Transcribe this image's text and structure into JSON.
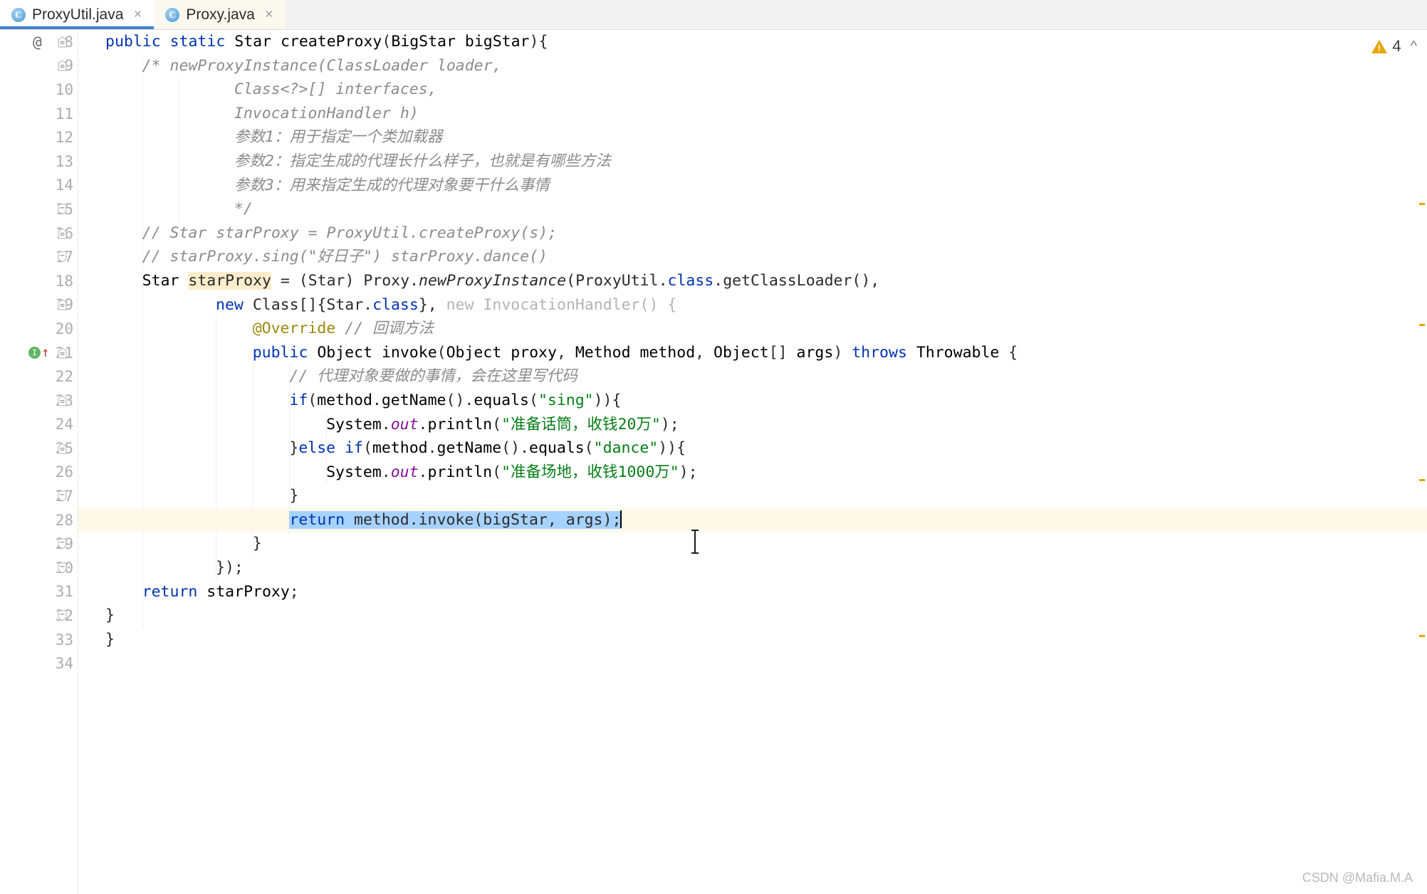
{
  "window": {
    "app": "IntelliJ IDEA Editor",
    "watermark": "CSDN @Mafia.M.A"
  },
  "tabs": [
    {
      "label": "ProxyUtil.java",
      "icon": "java-class-icon",
      "icon_letter": "C",
      "active": true,
      "close": "×"
    },
    {
      "label": "Proxy.java",
      "icon": "java-class-icon",
      "icon_letter": "C",
      "active": false,
      "close": "×"
    }
  ],
  "inspection": {
    "warning_icon": "warning-triangle-icon",
    "warning_count": "4",
    "collapse_icon": "chevron-up-icon"
  },
  "gutter": {
    "annotation_marker": "@",
    "run_marker_glyph": "I",
    "override_arrow": "↑"
  },
  "editor": {
    "language": "Java",
    "first_line_number": 8,
    "current_line": 28,
    "highlighted_identifier": "starProxy",
    "selection_text": "return method.invoke(bigStar, args);",
    "colors": {
      "keyword": "#0033b3",
      "string": "#067d17",
      "comment": "#8c8c8c",
      "annotation": "#9e880d",
      "static_field": "#871094",
      "greyed": "#b4b4b4",
      "identifier_highlight": "#fbeccb",
      "selection": "#a6d2ff",
      "current_line": "#fcf9e9",
      "tab_underline": "#3f7fd0"
    },
    "lines": [
      {
        "n": 8,
        "gutter": "at",
        "fold": "start",
        "text": "public static Star createProxy(BigStar bigStar){"
      },
      {
        "n": 9,
        "gutter": "",
        "fold": "start",
        "text": "    /* newProxyInstance(ClassLoader loader,"
      },
      {
        "n": 10,
        "gutter": "",
        "fold": "",
        "text": "              Class<?>[] interfaces,"
      },
      {
        "n": 11,
        "gutter": "",
        "fold": "",
        "text": "              InvocationHandler h)"
      },
      {
        "n": 12,
        "gutter": "",
        "fold": "",
        "text": "              参数1：用于指定一个类加载器"
      },
      {
        "n": 13,
        "gutter": "",
        "fold": "",
        "text": "              参数2：指定生成的代理长什么样子，也就是有哪些方法"
      },
      {
        "n": 14,
        "gutter": "",
        "fold": "",
        "text": "              参数3：用来指定生成的代理对象要干什么事情"
      },
      {
        "n": 15,
        "gutter": "",
        "fold": "end",
        "text": "              */"
      },
      {
        "n": 16,
        "gutter": "",
        "fold": "start",
        "text": "    // Star starProxy = ProxyUtil.createProxy(s);"
      },
      {
        "n": 17,
        "gutter": "",
        "fold": "end",
        "text": "    // starProxy.sing(\"好日子\") starProxy.dance()"
      },
      {
        "n": 18,
        "gutter": "",
        "fold": "",
        "text": "    Star starProxy = (Star) Proxy.newProxyInstance(ProxyUtil.class.getClassLoader(),"
      },
      {
        "n": 19,
        "gutter": "",
        "fold": "start",
        "text": "            new Class[]{Star.class}, new InvocationHandler() {"
      },
      {
        "n": 20,
        "gutter": "",
        "fold": "",
        "text": "                @Override // 回调方法"
      },
      {
        "n": 21,
        "gutter": "run",
        "fold": "start",
        "text": "                public Object invoke(Object proxy, Method method, Object[] args) throws Throwable {"
      },
      {
        "n": 22,
        "gutter": "",
        "fold": "",
        "text": "                    // 代理对象要做的事情，会在这里写代码"
      },
      {
        "n": 23,
        "gutter": "",
        "fold": "start",
        "text": "                    if(method.getName().equals(\"sing\")){"
      },
      {
        "n": 24,
        "gutter": "",
        "fold": "",
        "text": "                        System.out.println(\"准备话筒，收钱20万\");"
      },
      {
        "n": 25,
        "gutter": "",
        "fold": "start",
        "text": "                    }else if(method.getName().equals(\"dance\")){"
      },
      {
        "n": 26,
        "gutter": "",
        "fold": "",
        "text": "                        System.out.println(\"准备场地，收钱1000万\");"
      },
      {
        "n": 27,
        "gutter": "",
        "fold": "end",
        "text": "                    }"
      },
      {
        "n": 28,
        "gutter": "",
        "fold": "",
        "text": "                    return method.invoke(bigStar, args);"
      },
      {
        "n": 29,
        "gutter": "",
        "fold": "end",
        "text": "                }"
      },
      {
        "n": 30,
        "gutter": "",
        "fold": "end",
        "text": "            });"
      },
      {
        "n": 31,
        "gutter": "",
        "fold": "",
        "text": "    return starProxy;"
      },
      {
        "n": 32,
        "gutter": "",
        "fold": "end",
        "text": "}"
      },
      {
        "n": 33,
        "gutter": "",
        "fold": "",
        "text": "}"
      },
      {
        "n": 34,
        "gutter": "",
        "fold": "",
        "text": ""
      }
    ]
  }
}
